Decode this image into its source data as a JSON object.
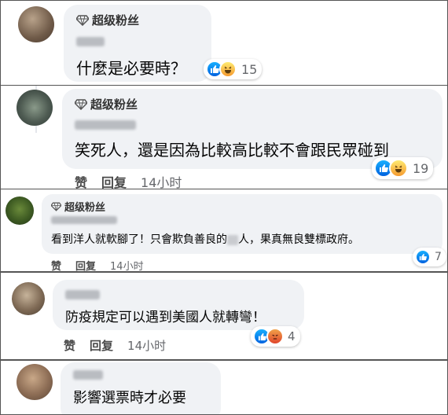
{
  "fan_badge": "超级粉丝",
  "actions": {
    "like": "赞",
    "reply": "回复"
  },
  "comments": [
    {
      "text": "什麼是必要時？",
      "reactions": "15"
    },
    {
      "text": "笑死人，還是因為比較高比較不會跟民眾碰到",
      "time": "14小时",
      "reactions": "19"
    },
    {
      "text_before": "看到洋人就軟腳了！只會欺負善良的",
      "text_after": "人，果真無良雙標政府。",
      "time": "14小时",
      "reactions": "7"
    },
    {
      "text": "防疫規定可以遇到美國人就轉彎！",
      "time": "14小时",
      "reactions": "4"
    },
    {
      "text": "影響選票時才必要"
    }
  ],
  "colors": {
    "like_blue": "#1877f2",
    "bubble_gray": "#f0f2f5",
    "panel_border": "#555555"
  },
  "icons": [
    "diamond-icon",
    "like-reaction-icon",
    "haha-reaction-icon",
    "angry-reaction-icon"
  ]
}
